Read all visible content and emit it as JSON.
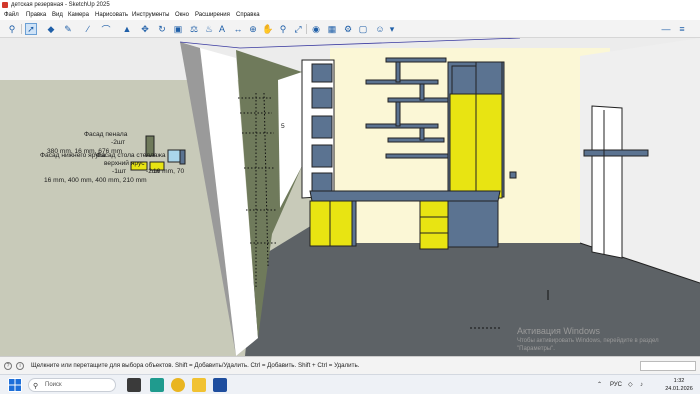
{
  "window": {
    "title": "детская резервная - SketchUp 2025"
  },
  "menu": [
    "Файл",
    "Правка",
    "Вид",
    "Камера",
    "Нарисовать",
    "Инструменты",
    "Окно",
    "Расширения",
    "Справка"
  ],
  "toolbar": {
    "tools": [
      "search",
      "select",
      "eraser",
      "pencil",
      "line",
      "arc",
      "rectangle",
      "push-pull",
      "move",
      "rotate",
      "offset",
      "tape",
      "paint",
      "text",
      "dimensions",
      "orbit",
      "pan",
      "zoom",
      "zoom-extents",
      "components",
      "warehouse",
      "extensions",
      "user"
    ]
  },
  "annotations": {
    "facade_pencil": "Фасад пенала",
    "qty_2_top": "-2шт",
    "dims_380": "380 mm, 16 mm, 676 mm",
    "facade_overlap1": "Фасад нижнего яруса",
    "facade_overlap2": "Фасад стола стеллажа",
    "upper_tier": "верхний ярус",
    "qty_1": "-1шт",
    "qty_2_mid": "-2шт",
    "dims_left": "16 mm, 400 mm, 400 mm, 210 mm",
    "dims_right_frag": "16 mm, 70",
    "dim_5": "5"
  },
  "status": {
    "message": "Щелкните или перетащите для выбора объектов. Shift = Добавить/Удалить. Ctrl = Добавить. Shift + Ctrl = Удалить."
  },
  "watermark": {
    "title": "Активация Windows",
    "line1": "Чтобы активировать Windows, перейдите в раздел",
    "line2": "\"Параметры\"."
  },
  "taskbar": {
    "search_placeholder": "Поиск",
    "lang": "РУС",
    "time": "1:32",
    "date": "24.01.2026"
  },
  "colors": {
    "wall_green": "#6f7a5b",
    "yellow": "#e8e412",
    "blue_gray": "#5b7391",
    "floor": "#5d6266",
    "cream": "#fbf7d6"
  }
}
